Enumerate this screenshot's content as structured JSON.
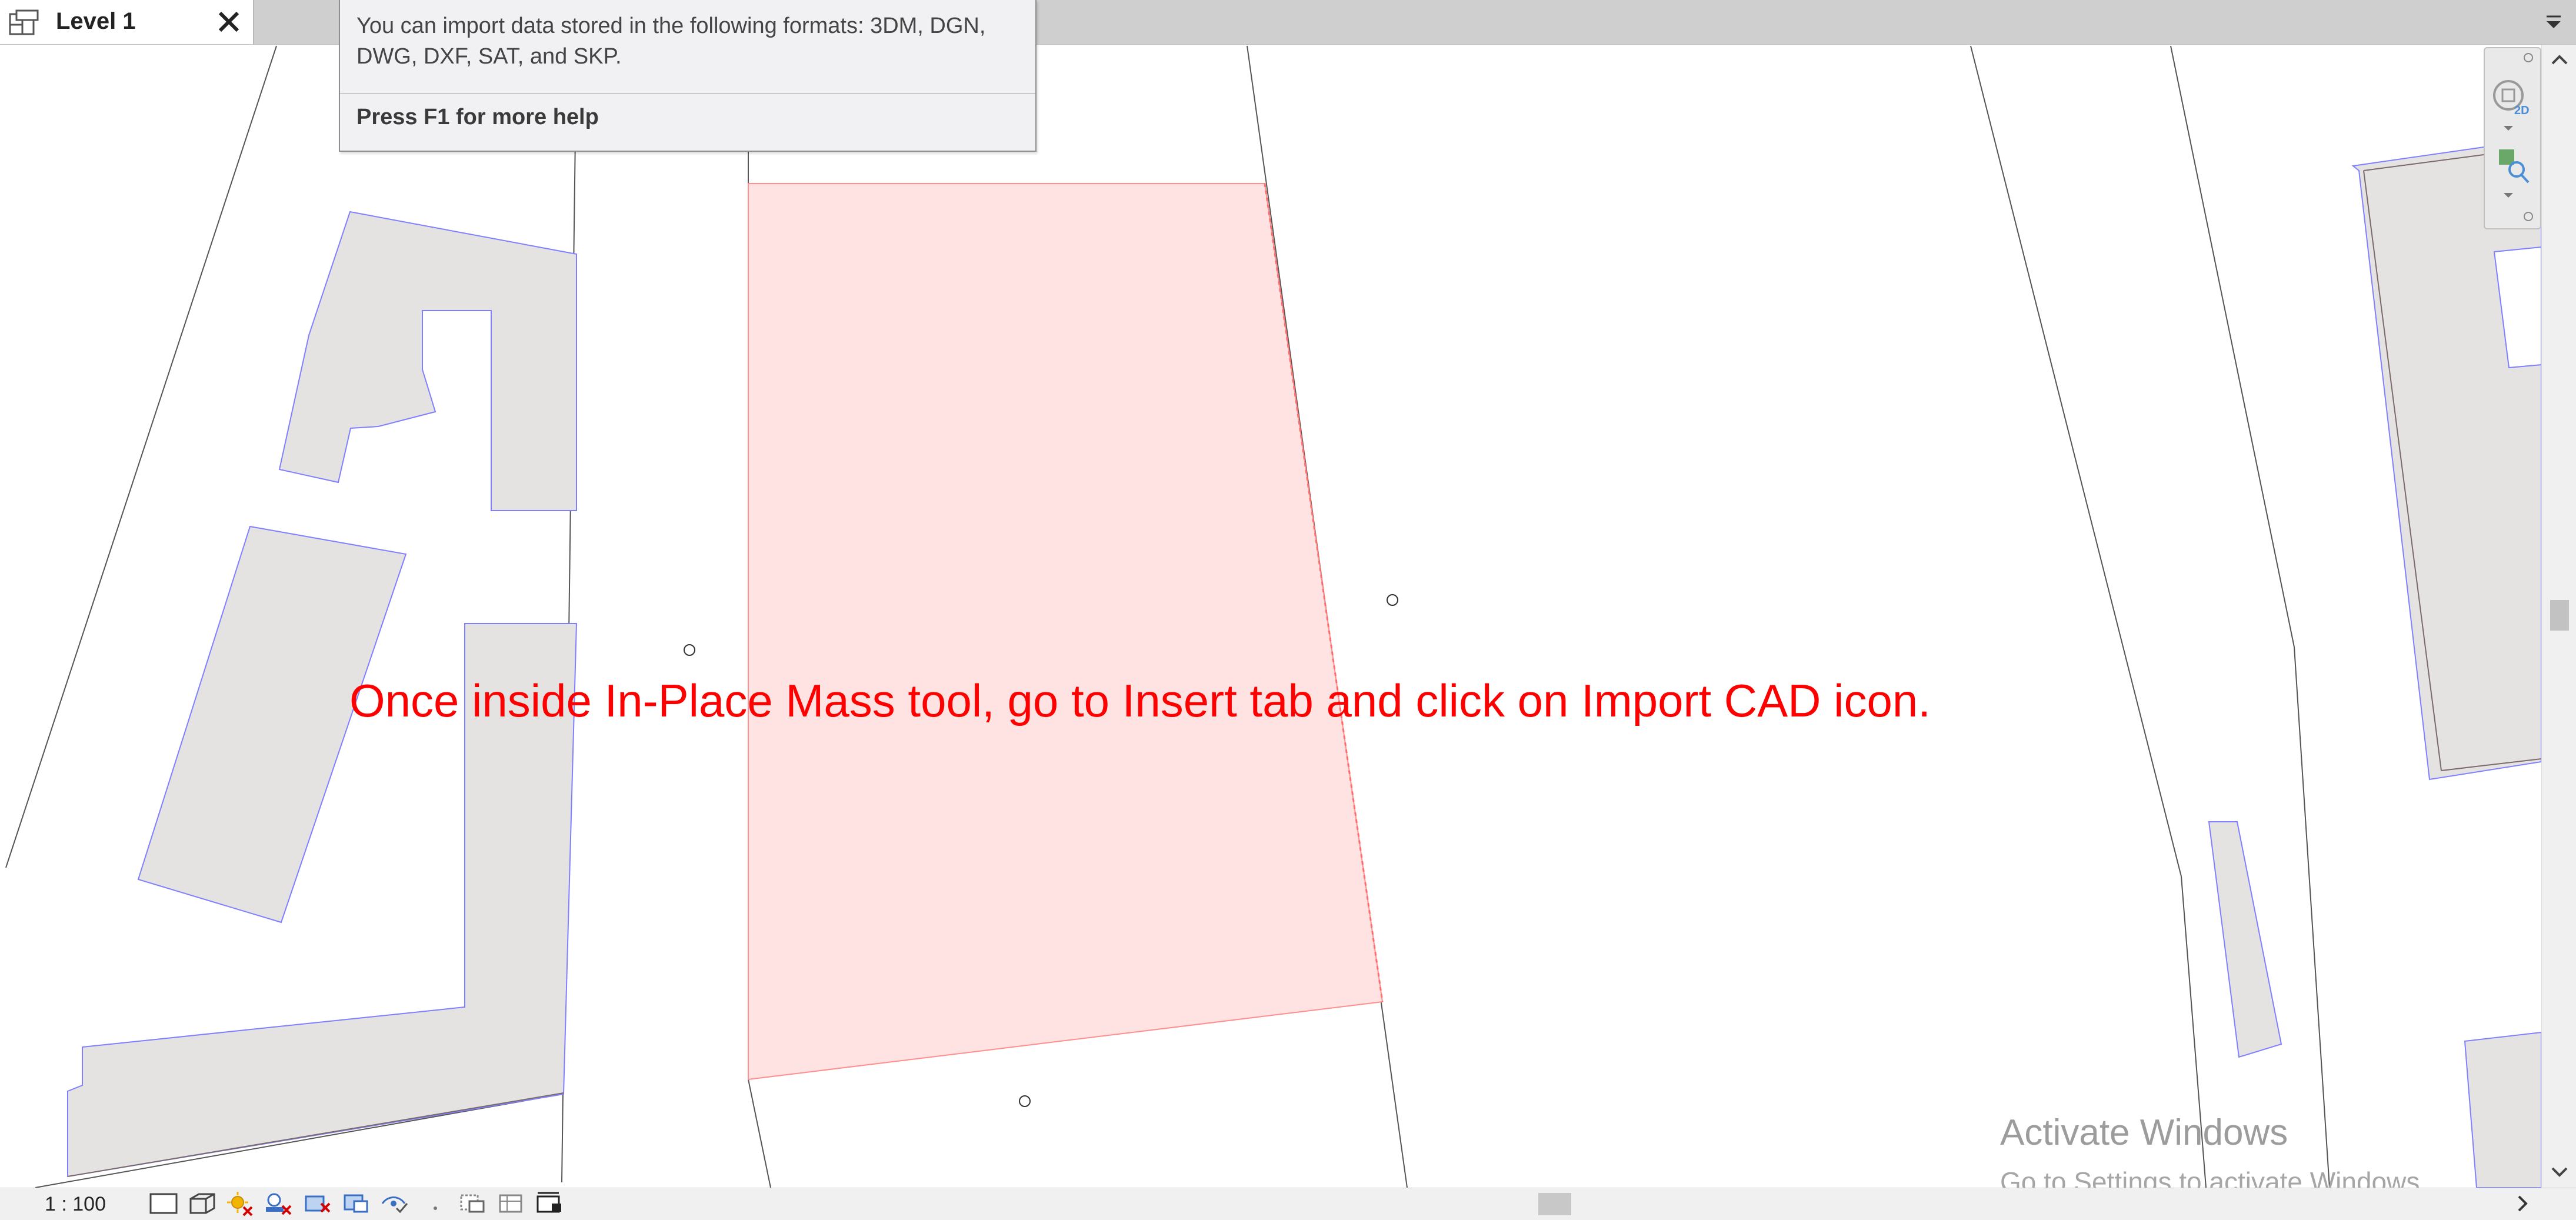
{
  "tab": {
    "label": "Level 1",
    "view_icon": "floor-plan-icon",
    "close_icon": "close-icon"
  },
  "tooltip": {
    "body": "You can import data stored in the following formats: 3DM, DGN, DWG, DXF, SAT, and SKP.",
    "help": "Press F1 for more help"
  },
  "annotation": {
    "text": "Once inside In-Place Mass tool, go to Insert tab and click on Import CAD icon.",
    "color": "#ff0000"
  },
  "watermark": {
    "title": "Activate Windows",
    "subtitle": "Go to Settings to activate Windows."
  },
  "status": {
    "scale": "1 : 100"
  },
  "colors": {
    "mass_fill": "#ffe2e2",
    "mass_stroke": "#ff8f8f",
    "building_fill": "#e5e2e2",
    "building_stroke": "#8080ff",
    "line": "#555555"
  },
  "view_controls": [
    {
      "name": "detail-level-icon"
    },
    {
      "name": "visual-style-icon"
    },
    {
      "name": "sun-path-icon"
    },
    {
      "name": "shadows-icon"
    },
    {
      "name": "crop-view-icon"
    },
    {
      "name": "show-crop-region-icon"
    },
    {
      "name": "temporary-hide-icon"
    },
    {
      "name": "reveal-hidden-icon"
    },
    {
      "name": "worksharing-icon"
    },
    {
      "name": "design-options-icon"
    },
    {
      "name": "highlight-displacement-icon"
    }
  ]
}
